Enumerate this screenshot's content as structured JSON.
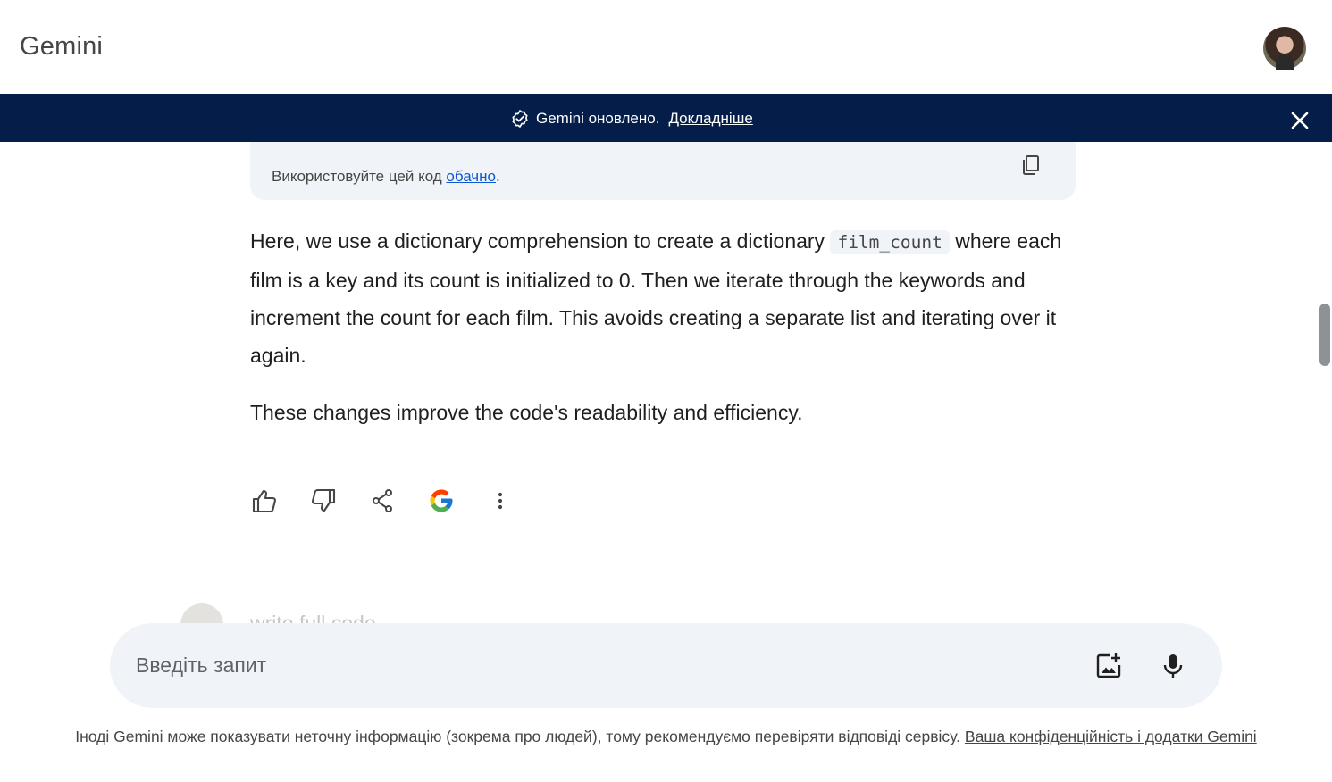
{
  "header": {
    "app_title": "Gemini",
    "avatar_icon": "user-avatar"
  },
  "banner": {
    "icon": "verified-badge-icon",
    "message": "Gemini оновлено.",
    "link": "Докладніше",
    "close_icon": "close-icon",
    "background": "#041e49"
  },
  "code_block": {
    "note_prefix": "Використовуйте цей код ",
    "note_link": "обачно",
    "note_suffix": ".",
    "copy_icon": "copy-icon"
  },
  "response": {
    "para1_before": "Here, we use a dictionary comprehension to create a dictionary ",
    "inline_code": "film_count",
    "para1_after": " where each film is a key and its count is initialized to 0. Then we iterate through the keywords and increment the count for each film. This avoids creating a separate list and iterating over it again.",
    "para2": "These changes improve the code's readability and efficiency."
  },
  "actions": [
    {
      "icon": "thumbs-up-icon"
    },
    {
      "icon": "thumbs-down-icon"
    },
    {
      "icon": "share-icon"
    },
    {
      "icon": "google-icon"
    },
    {
      "icon": "more-vert-icon"
    }
  ],
  "previous_prompt": {
    "text": "write full code"
  },
  "input": {
    "placeholder": "Введіть запит",
    "image_icon": "add-image-icon",
    "mic_icon": "mic-icon"
  },
  "footer": {
    "disclaimer": "Іноді Gemini може показувати неточну інформацію (зокрема про людей), тому рекомендуємо перевіряти відповіді сервісу.",
    "link": "Ваша конфіденційність і додатки Gemini"
  },
  "colors": {
    "accent_link": "#0b57d0",
    "surface": "#f0f4f9",
    "text": "#1f1f1f"
  }
}
